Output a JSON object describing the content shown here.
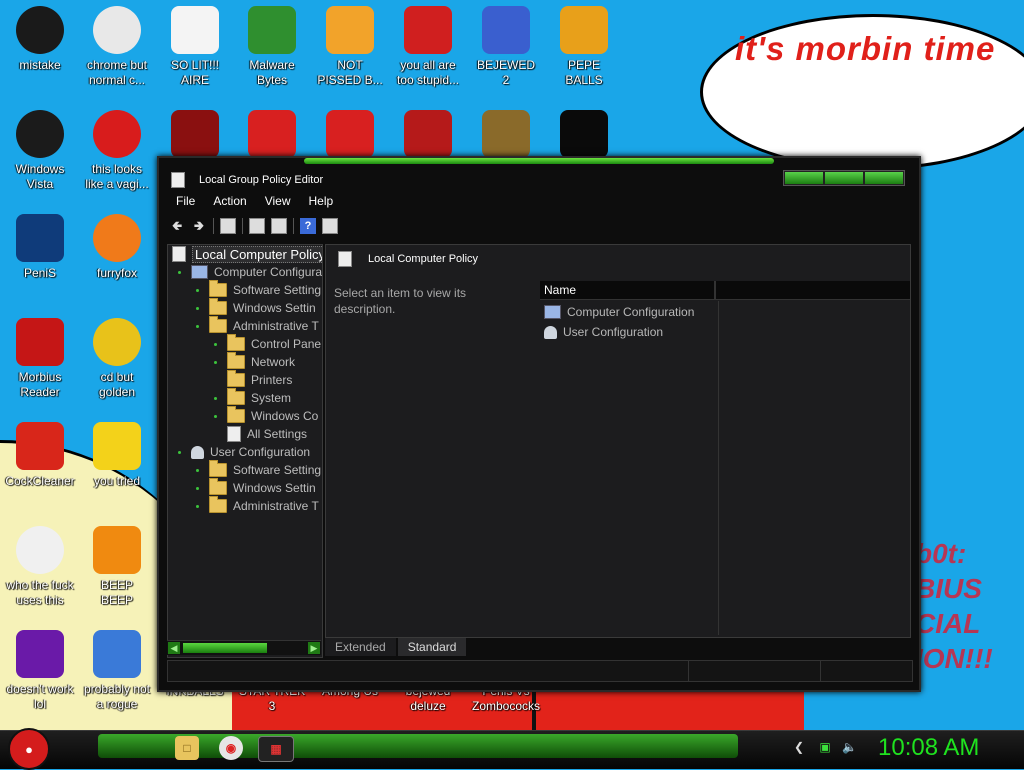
{
  "wallpaper": {
    "bubble_text": "it's morbin time",
    "side_text": "b0t:\nBIUS\nCIAL\nION!!!"
  },
  "desktop_icons": [
    {
      "label": "mistake",
      "icon": "mistake-icon",
      "color": "#1a1a1a"
    },
    {
      "label": "chrome but\nnormal c...",
      "icon": "chrome-icon",
      "color": "#e8e8e8"
    },
    {
      "label": "SO LIT!!!\nAIRE",
      "icon": "solitaire-icon",
      "color": "#f4f4f4"
    },
    {
      "label": "Malware\nBytes",
      "icon": "shield-icon",
      "color": "#2f8f2f"
    },
    {
      "label": "NOT\nPISSED B...",
      "icon": "pig-icon",
      "color": "#f2a32a"
    },
    {
      "label": "you all are\ntoo stupid...",
      "icon": "devcpp-icon",
      "color": "#d01f1f"
    },
    {
      "label": "BEJEWED\n2",
      "icon": "bejeweled-icon",
      "color": "#3a5fcf"
    },
    {
      "label": "PEPE\nBALLS",
      "icon": "pepe-icon",
      "color": "#e8a01a"
    },
    {
      "label": "Windows\nVista",
      "icon": "recycle-bin-icon",
      "color": "#1b1b1b"
    },
    {
      "label": "this looks\nlike a vagi...",
      "icon": "opera-icon",
      "color": "#d81c1c"
    },
    {
      "label": "",
      "icon": "flash-icon",
      "color": "#8a1010"
    },
    {
      "label": "",
      "icon": "angry-bird-icon",
      "color": "#d82020"
    },
    {
      "label": "",
      "icon": "angry-bird-icon-2",
      "color": "#d82020"
    },
    {
      "label": "",
      "icon": "game-banner-icon",
      "color": "#b51a1a"
    },
    {
      "label": "",
      "icon": "money-bag-icon",
      "color": "#8a6a2a"
    },
    {
      "label": "",
      "icon": "cmd-icon",
      "color": "#0a0a0a"
    },
    {
      "label": "PeniS",
      "icon": "photoshop-icon",
      "color": "#0f3b7a"
    },
    {
      "label": "furryfox",
      "icon": "firefox-icon",
      "color": "#f07a1a"
    },
    {
      "label": "Morbius\nReader",
      "icon": "pdf-reader-icon",
      "color": "#c51616"
    },
    {
      "label": "cd but\ngolden",
      "icon": "cd-icon",
      "color": "#e8c21a"
    },
    {
      "label": "CockCleaner",
      "icon": "ccleaner-icon",
      "color": "#d8261a"
    },
    {
      "label": "you tried",
      "icon": "star-icon",
      "color": "#f3d21a"
    },
    {
      "label": "who the fuck\nuses this",
      "icon": "lightning-icon",
      "color": "#f0f0f0"
    },
    {
      "label": "BEEP\nBEEP",
      "icon": "vlc-icon",
      "color": "#f08a10"
    },
    {
      "label": "doesn't work\nlol",
      "icon": "yahoo-icon",
      "color": "#6a1aa8"
    },
    {
      "label": "probably not\na rogue",
      "icon": "settings-monitor-icon",
      "color": "#3a7ad8"
    }
  ],
  "hidden_labels": [
    "INKBALLS",
    "STAR TREK\n3",
    "Among Us",
    "bejewed\ndeluze",
    "Penis Vs\nZombococks"
  ],
  "window": {
    "title": "Local Group Policy Editor",
    "menu": [
      "File",
      "Action",
      "View",
      "Help"
    ],
    "tree": {
      "root": "Local Computer Policy",
      "computer_config": "Computer Configura",
      "cc_software": "Software Setting",
      "cc_windows": "Windows Settin",
      "cc_admin": "Administrative T",
      "cp": "Control Pane",
      "network": "Network",
      "printers": "Printers",
      "system": "System",
      "wc": "Windows Co",
      "all": "All Settings",
      "user_config": "User Configuration",
      "uc_software": "Software Setting",
      "uc_windows": "Windows Settin",
      "uc_admin": "Administrative T"
    },
    "right": {
      "title": "Local Computer Policy",
      "description": "Select an item to view its description.",
      "column_name": "Name",
      "items": [
        "Computer Configuration",
        "User Configuration"
      ]
    },
    "tabs": [
      "Extended",
      "Standard"
    ],
    "active_tab": "Standard"
  },
  "taskbar": {
    "clock": "10:08 AM"
  }
}
